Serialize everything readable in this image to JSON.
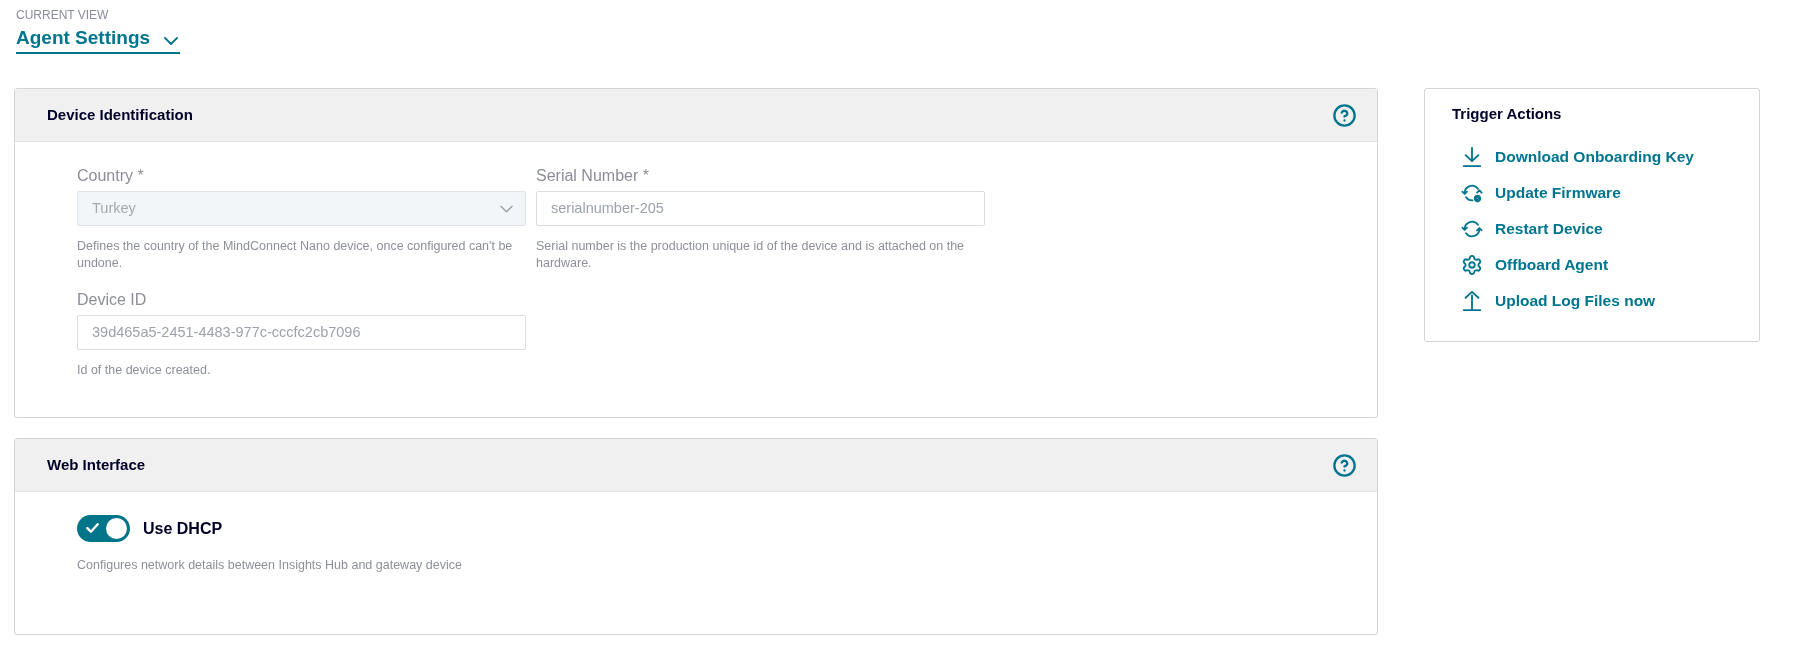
{
  "view_selector": {
    "caption": "CURRENT VIEW",
    "value": "Agent Settings"
  },
  "panels": [
    {
      "title": "Device Identification",
      "fields": [
        {
          "kind": "select",
          "label": "Country *",
          "value": "Turkey",
          "disabled": true,
          "help": "Defines the country of the MindConnect Nano device, once configured can't be undone."
        },
        {
          "kind": "text",
          "label": "Serial Number *",
          "value": "serialnumber-205",
          "disabled": false,
          "help": "Serial number is the production unique id of the device and is attached on the hardware."
        },
        {
          "kind": "text",
          "label": "Device ID",
          "value": "39d465a5-2451-4483-977c-cccfc2cb7096",
          "disabled": false,
          "help": "Id of the device created."
        }
      ]
    },
    {
      "title": "Web Interface",
      "fields": [
        {
          "kind": "toggle",
          "label": "Use DHCP",
          "on": true,
          "help": "Configures network details between Insights Hub and gateway device"
        }
      ]
    }
  ],
  "trigger_actions": {
    "title": "Trigger Actions",
    "items": [
      {
        "kind": "download",
        "label": "Download Onboarding Key"
      },
      {
        "kind": "update",
        "label": "Update Firmware"
      },
      {
        "kind": "restart",
        "label": "Restart Device"
      },
      {
        "kind": "settings",
        "label": "Offboard Agent"
      },
      {
        "kind": "upload",
        "label": "Upload Log Files now"
      }
    ]
  }
}
